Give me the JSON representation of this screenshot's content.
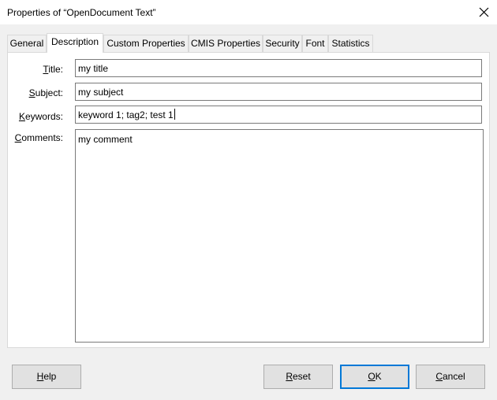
{
  "window": {
    "title": "Properties of “OpenDocument Text”",
    "close_icon": "close-icon"
  },
  "tabs": [
    {
      "label": "General"
    },
    {
      "label": "Description",
      "active": true
    },
    {
      "label": "Custom Properties"
    },
    {
      "label": "CMIS Properties"
    },
    {
      "label": "Security"
    },
    {
      "label": "Font"
    },
    {
      "label": "Statistics"
    }
  ],
  "form": {
    "title": {
      "label_mnemonic": "T",
      "label_rest": "itle:",
      "value": "my title"
    },
    "subject": {
      "label_mnemonic": "S",
      "label_rest": "ubject:",
      "value": "my subject"
    },
    "keywords": {
      "label_mnemonic": "K",
      "label_rest": "eywords:",
      "value": "keyword 1; tag2; test 1"
    },
    "comments": {
      "label_mnemonic": "C",
      "label_rest": "omments:",
      "value": "my comment"
    }
  },
  "buttons": {
    "help": {
      "mnemonic": "H",
      "rest": "elp"
    },
    "reset": {
      "mnemonic": "R",
      "rest": "eset"
    },
    "ok": {
      "mnemonic": "O",
      "rest": "K"
    },
    "cancel": {
      "mnemonic": "C",
      "rest": "ancel"
    }
  },
  "colors": {
    "accent": "#0078d7",
    "panel_bg": "#ffffff",
    "dialog_bg": "#f0f0f0"
  }
}
